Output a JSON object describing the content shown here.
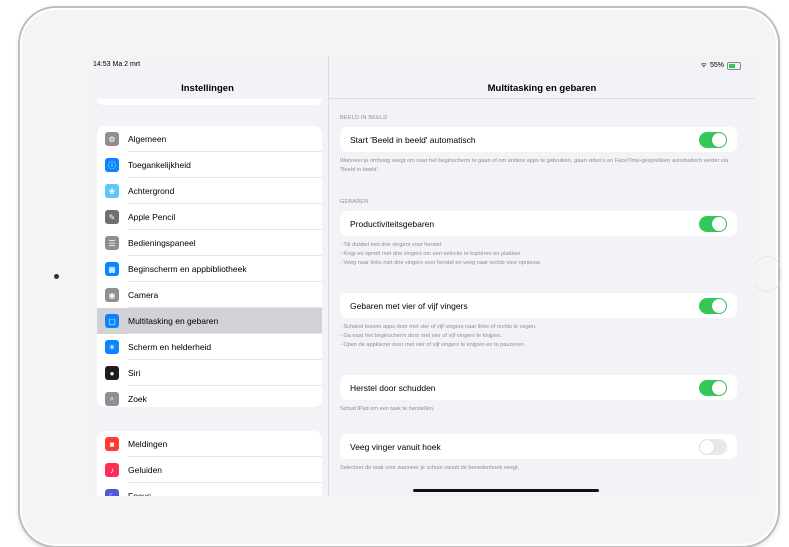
{
  "status": {
    "time": "14:53",
    "date": "Ma 2 mrt",
    "battery": "55%"
  },
  "sidebar": {
    "title": "Instellingen",
    "group1": [
      {
        "label": "Algemeen",
        "icon": "gear-icon",
        "color": "#8e8e93",
        "glyph": "⚙"
      },
      {
        "label": "Toegankelijkheid",
        "icon": "accessibility-icon",
        "color": "#0a84ff",
        "glyph": "ⓘ"
      },
      {
        "label": "Achtergrond",
        "icon": "wallpaper-icon",
        "color": "#5ac8fa",
        "glyph": "❀"
      },
      {
        "label": "Apple Pencil",
        "icon": "pencil-icon",
        "color": "#6e6e73",
        "glyph": "✎"
      },
      {
        "label": "Bedieningspaneel",
        "icon": "control-center-icon",
        "color": "#8e8e93",
        "glyph": "☰"
      },
      {
        "label": "Beginscherm en appbibliotheek",
        "icon": "home-screen-icon",
        "color": "#0a84ff",
        "glyph": "▦"
      },
      {
        "label": "Camera",
        "icon": "camera-icon",
        "color": "#8e8e93",
        "glyph": "◉"
      },
      {
        "label": "Multitasking en gebaren",
        "icon": "multitasking-icon",
        "color": "#0a84ff",
        "glyph": "▢",
        "active": true
      },
      {
        "label": "Scherm en helderheid",
        "icon": "brightness-icon",
        "color": "#0a84ff",
        "glyph": "☀"
      },
      {
        "label": "Siri",
        "icon": "siri-icon",
        "color": "#1c1c1e",
        "glyph": "●"
      },
      {
        "label": "Zoek",
        "icon": "search-icon",
        "color": "#8e8e93",
        "glyph": "⌕"
      }
    ],
    "group2": [
      {
        "label": "Meldingen",
        "icon": "notifications-icon",
        "color": "#ff3b30",
        "glyph": "■"
      },
      {
        "label": "Geluiden",
        "icon": "sounds-icon",
        "color": "#ff2d55",
        "glyph": "♪"
      },
      {
        "label": "Focus",
        "icon": "focus-icon",
        "color": "#5856d6",
        "glyph": "☾"
      }
    ]
  },
  "detail": {
    "title": "Multitasking en gebaren",
    "section_beeld": "BEELD IN BEELD",
    "pip": {
      "label": "Start 'Beeld in beeld' automatisch",
      "on": true,
      "footer": "Wanneer je omhoog veegt om naar het beginscherm te gaan of om andere apps te gebruiken, gaan video's en FaceTime-gesprekken automatisch verder via 'Beeld in beeld'."
    },
    "section_gebaren": "GEBAREN",
    "productivity": {
      "label": "Productiviteitsgebaren",
      "on": true,
      "footer_lines": [
        "- Tik dubbel met drie vingers voor herstel.",
        "- Knijp en spreid met drie vingers om een selectie te kopiëren en plakken.",
        "- Veeg naar links met drie vingers voor herstel en veeg naar rechts voor opnieuw."
      ]
    },
    "fourfive": {
      "label": "Gebaren met vier of vijf vingers",
      "on": true,
      "footer_lines": [
        "- Schakel tussen apps door met vier of vijf vingers naar links of rechts te vegen.",
        "- Ga naar het beginscherm door met vier of vijf vingers te knijpen.",
        "- Open de appkiezer door met vier of vijf vingers te knijpen en te pauzeren."
      ]
    },
    "shake": {
      "label": "Herstel door schudden",
      "on": true,
      "footer": "Schud iPad om een taak te herstellen."
    },
    "corner": {
      "label": "Veeg vinger vanuit hoek",
      "on": false,
      "footer": "Selecteer de taak voor wanneer je schuin vanuit de benedenhoek veegt."
    }
  }
}
